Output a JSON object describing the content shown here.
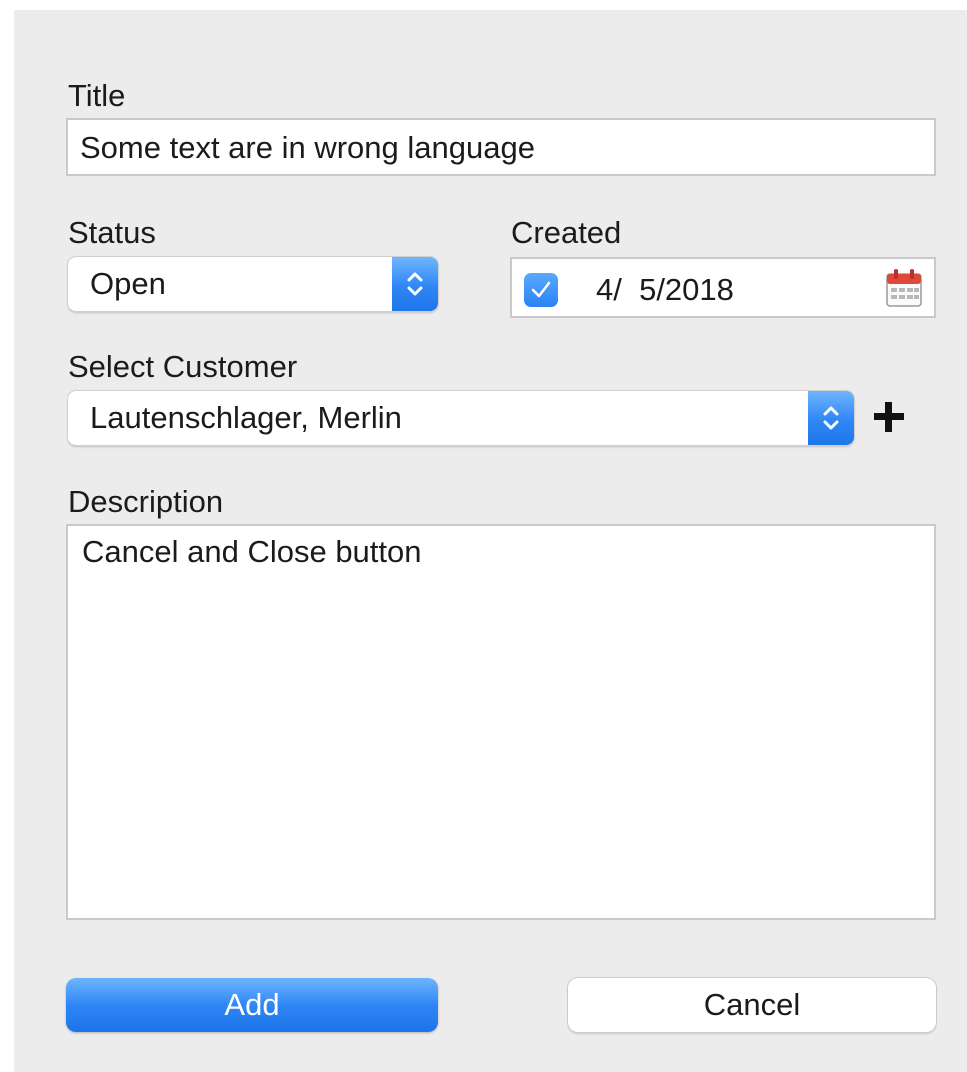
{
  "form": {
    "title_label": "Title",
    "title_value": "Some text are in wrong language",
    "status_label": "Status",
    "status_value": "Open",
    "created_label": "Created",
    "created_checked": true,
    "created_value": "4/  5/2018",
    "customer_label": "Select Customer",
    "customer_value": "Lautenschlager, Merlin",
    "description_label": "Description",
    "description_value": "Cancel and Close button"
  },
  "buttons": {
    "add_label": "Add",
    "cancel_label": "Cancel"
  },
  "icons": {
    "stepper": "up-down-chevron-icon",
    "calendar": "calendar-icon",
    "checkmark": "checkmark-icon",
    "add_customer": "plus-icon"
  },
  "colors": {
    "accent": "#2f86f5",
    "panel_background": "#ececec",
    "calendar_red": "#e0483c"
  }
}
